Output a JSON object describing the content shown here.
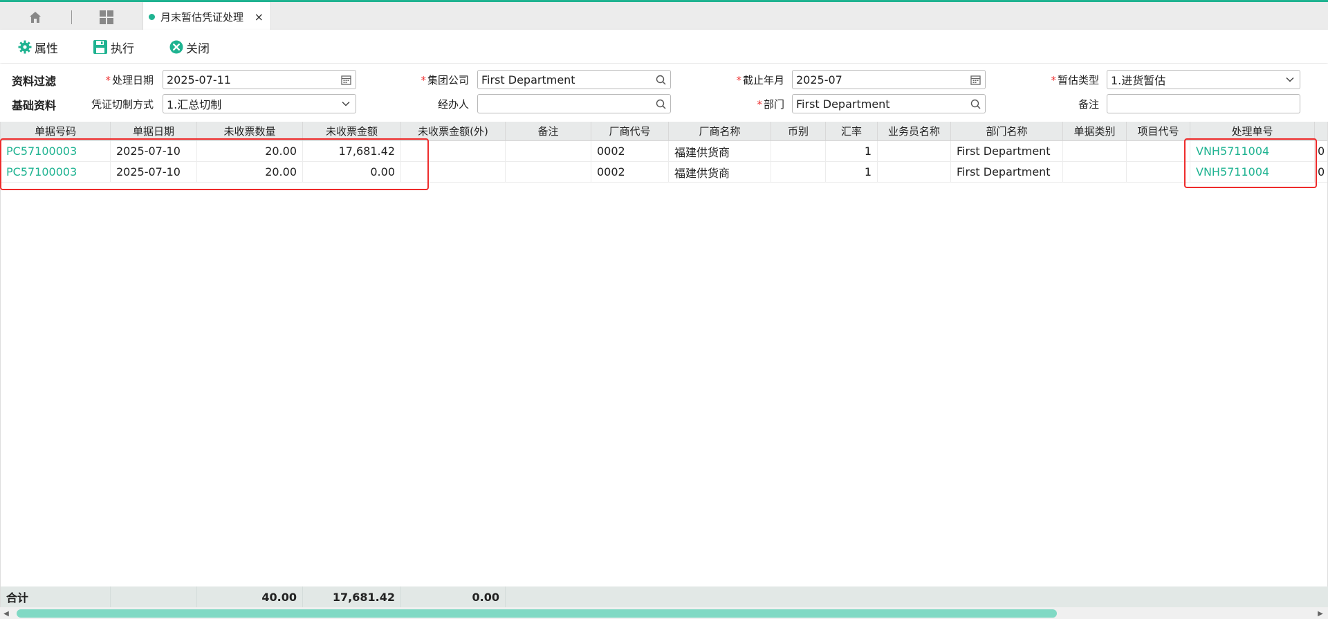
{
  "tabs": {
    "active_title": "月末暂估凭证处理",
    "close_glyph": "×"
  },
  "toolbar": {
    "properties_label": "属性",
    "execute_label": "执行",
    "close_label": "关闭"
  },
  "filter": {
    "section_filter": "资料过滤",
    "section_basic": "基础资料",
    "process_date_label": "处理日期",
    "process_date_value": "2025-07-11",
    "group_company_label": "集团公司",
    "group_company_value": "First Department",
    "cutoff_month_label": "截止年月",
    "cutoff_month_value": "2025-07",
    "estimate_type_label": "暂估类型",
    "estimate_type_value": "1.进货暂估",
    "voucher_mode_label": "凭证切制方式",
    "voucher_mode_value": "1.汇总切制",
    "handler_label": "经办人",
    "handler_value": "",
    "department_label": "部门",
    "department_value": "First Department",
    "remark_label": "备注",
    "remark_value": ""
  },
  "table": {
    "columns": [
      "单据号码",
      "单据日期",
      "未收票数量",
      "未收票金额",
      "未收票金额(外)",
      "备注",
      "厂商代号",
      "厂商名称",
      "币别",
      "汇率",
      "业务员名称",
      "部门名称",
      "单据类别",
      "项目代号",
      "处理单号",
      ""
    ],
    "rows": [
      [
        "PC57100003",
        "2025-07-10",
        "20.00",
        "17,681.42",
        "",
        "",
        "0002",
        "福建供货商",
        "",
        "1",
        "",
        "First Department",
        "",
        "",
        "VNH5711004",
        "0"
      ],
      [
        "PC57100003",
        "2025-07-10",
        "20.00",
        "0.00",
        "",
        "",
        "0002",
        "福建供货商",
        "",
        "1",
        "",
        "First Department",
        "",
        "",
        "VNH5711004",
        "0"
      ]
    ],
    "summary": {
      "label": "合计",
      "qty_total": "40.00",
      "amount_total": "17,681.42",
      "foreign_total": "0.00"
    }
  },
  "colors": {
    "accent": "#1fb391",
    "highlight": "#ee2b2b",
    "required": "#e33333"
  }
}
